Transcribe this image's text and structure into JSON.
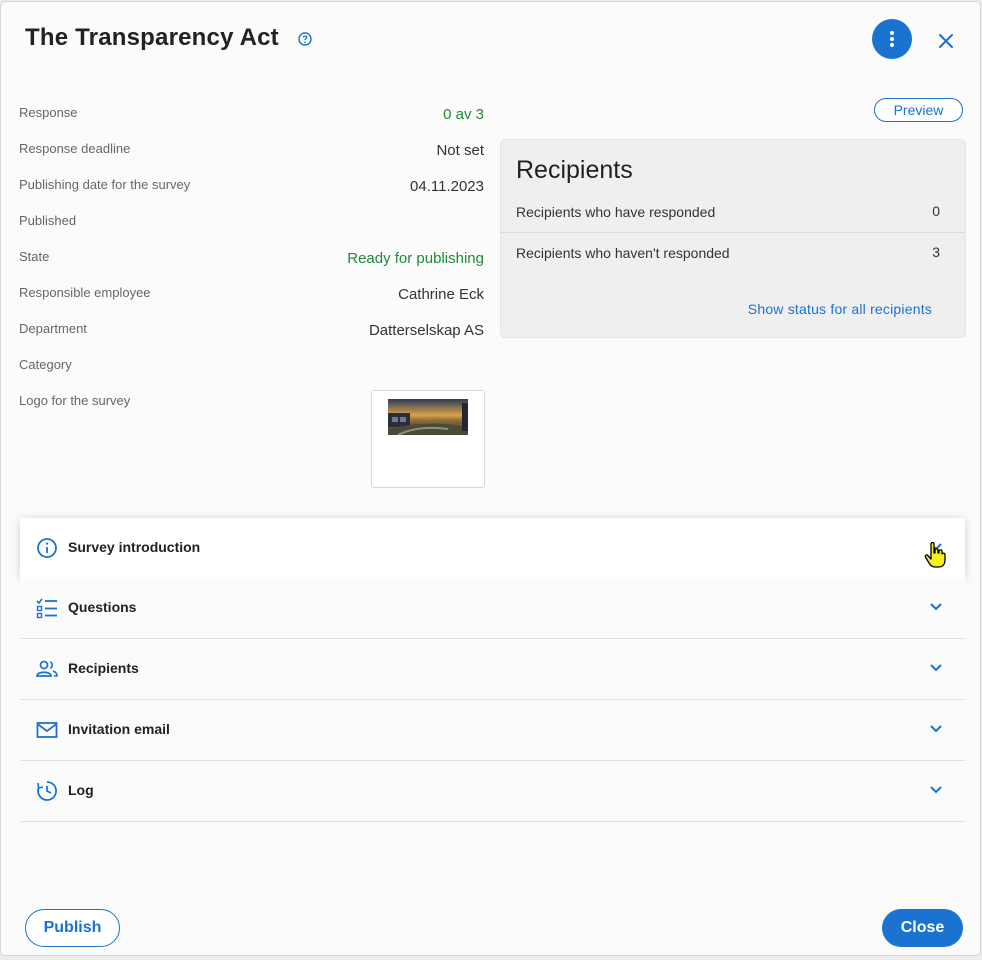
{
  "dialog": {
    "title": "The Transparency Act",
    "preview_label": "Preview",
    "publish_label": "Publish",
    "close_label": "Close"
  },
  "fields": [
    {
      "label": "Response",
      "value": "0 av 3",
      "color": "#1e8a3a"
    },
    {
      "label": "Response deadline",
      "value": "Not set"
    },
    {
      "label": "Publishing date for the survey",
      "value": "04.11.2023"
    },
    {
      "label": "Published",
      "value": ""
    },
    {
      "label": "State",
      "value": "Ready for publishing",
      "color": "#1e8a3a"
    },
    {
      "label": "Responsible employee",
      "value": "Cathrine Eck"
    },
    {
      "label": "Department",
      "value": "Datterselskap AS"
    },
    {
      "label": "Category",
      "value": ""
    },
    {
      "label": "Logo for the survey",
      "value": ""
    }
  ],
  "recipients_card": {
    "title": "Recipients",
    "rows": [
      {
        "label": "Recipients who have responded",
        "value": "0"
      },
      {
        "label": "Recipients who haven't responded",
        "value": "3"
      }
    ],
    "link": "Show status for all recipients"
  },
  "sections": [
    {
      "label": "Survey introduction",
      "icon": "info-icon",
      "active": true
    },
    {
      "label": "Questions",
      "icon": "checklist-icon"
    },
    {
      "label": "Recipients",
      "icon": "people-icon"
    },
    {
      "label": "Invitation email",
      "icon": "mail-icon"
    },
    {
      "label": "Log",
      "icon": "history-icon"
    }
  ],
  "colors": {
    "accent": "#1a73d1",
    "success": "#1e8a3a"
  }
}
